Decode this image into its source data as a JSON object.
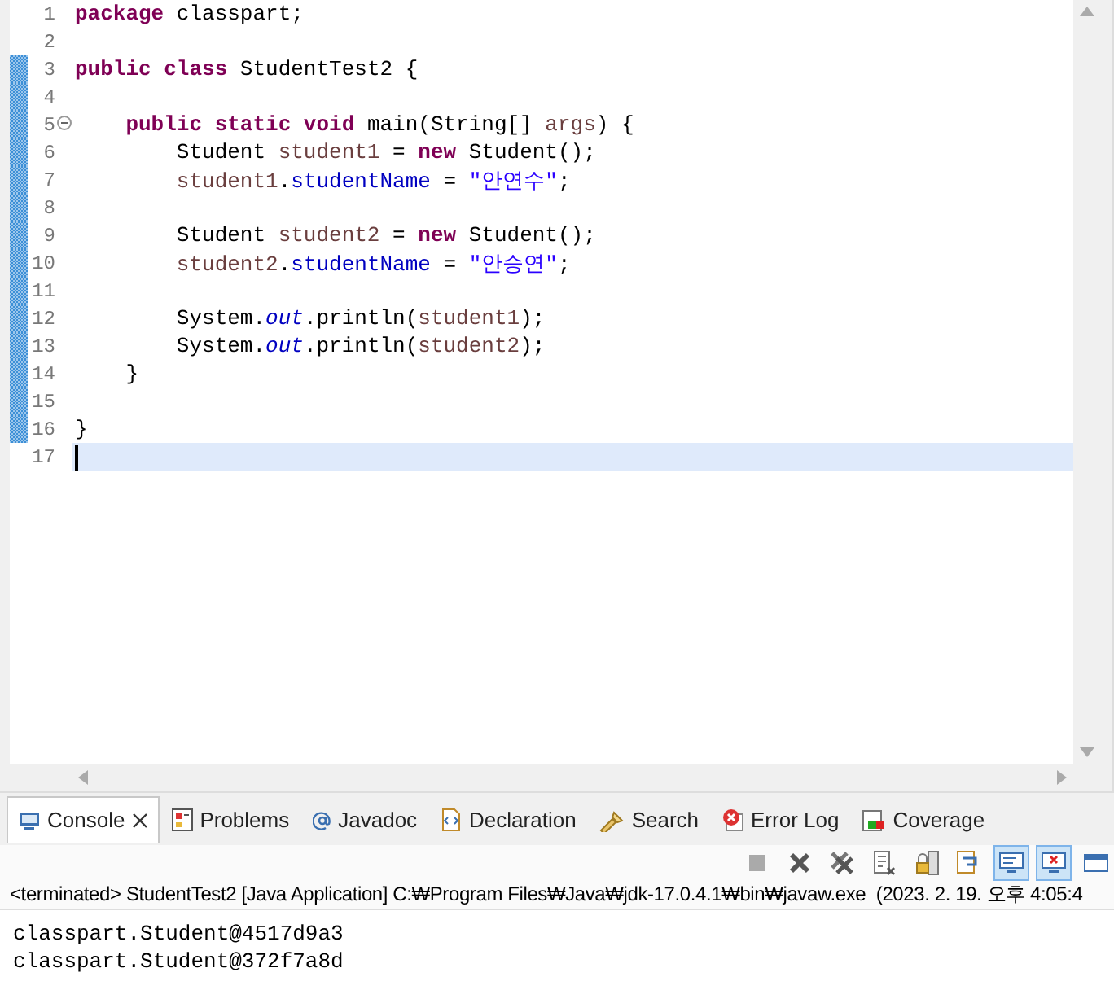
{
  "editor": {
    "lines": [
      {
        "number": "1",
        "changed": false,
        "fold": false,
        "current": false,
        "tokens": [
          {
            "kind": "kw",
            "text": "package"
          },
          {
            "kind": "plain",
            "text": " classpart;"
          }
        ]
      },
      {
        "number": "2",
        "changed": false,
        "fold": false,
        "current": false
      },
      {
        "number": "3",
        "changed": true,
        "fold": false,
        "current": false,
        "tokens": [
          {
            "kind": "kw",
            "text": "public class"
          },
          {
            "kind": "plain",
            "text": " StudentTest2 {"
          }
        ]
      },
      {
        "number": "4",
        "changed": true,
        "fold": false,
        "current": false
      },
      {
        "number": "5",
        "changed": true,
        "fold": true,
        "current": false,
        "tokens": [
          {
            "kind": "kw",
            "text": "    public static void"
          },
          {
            "kind": "plain",
            "text": " main(String[] "
          },
          {
            "kind": "var",
            "text": "args"
          },
          {
            "kind": "plain",
            "text": ") {"
          }
        ]
      },
      {
        "number": "6",
        "changed": true,
        "fold": false,
        "current": false,
        "tokens": [
          {
            "kind": "plain",
            "text": "        Student "
          },
          {
            "kind": "var",
            "text": "student1"
          },
          {
            "kind": "plain",
            "text": " = "
          },
          {
            "kind": "kw",
            "text": "new"
          },
          {
            "kind": "plain",
            "text": " Student();"
          }
        ]
      },
      {
        "number": "7",
        "changed": true,
        "fold": false,
        "current": false,
        "tokens": [
          {
            "kind": "var",
            "text": "        student1"
          },
          {
            "kind": "plain",
            "text": "."
          },
          {
            "kind": "field",
            "text": "studentName"
          },
          {
            "kind": "plain",
            "text": " = "
          },
          {
            "kind": "str",
            "text": "\"안연수\""
          },
          {
            "kind": "plain",
            "text": ";"
          }
        ]
      },
      {
        "number": "8",
        "changed": true,
        "fold": false,
        "current": false
      },
      {
        "number": "9",
        "changed": true,
        "fold": false,
        "current": false,
        "tokens": [
          {
            "kind": "plain",
            "text": "        Student "
          },
          {
            "kind": "var",
            "text": "student2"
          },
          {
            "kind": "plain",
            "text": " = "
          },
          {
            "kind": "kw",
            "text": "new"
          },
          {
            "kind": "plain",
            "text": " Student();"
          }
        ]
      },
      {
        "number": "10",
        "changed": true,
        "fold": false,
        "current": false,
        "tokens": [
          {
            "kind": "var",
            "text": "        student2"
          },
          {
            "kind": "plain",
            "text": "."
          },
          {
            "kind": "field",
            "text": "studentName"
          },
          {
            "kind": "plain",
            "text": " = "
          },
          {
            "kind": "str",
            "text": "\"안승연\""
          },
          {
            "kind": "plain",
            "text": ";"
          }
        ]
      },
      {
        "number": "11",
        "changed": true,
        "fold": false,
        "current": false
      },
      {
        "number": "12",
        "changed": true,
        "fold": false,
        "current": false,
        "tokens": [
          {
            "kind": "plain",
            "text": "        System."
          },
          {
            "kind": "static",
            "text": "out"
          },
          {
            "kind": "plain",
            "text": ".println("
          },
          {
            "kind": "var",
            "text": "student1"
          },
          {
            "kind": "plain",
            "text": ");"
          }
        ]
      },
      {
        "number": "13",
        "changed": true,
        "fold": false,
        "current": false,
        "tokens": [
          {
            "kind": "plain",
            "text": "        System."
          },
          {
            "kind": "static",
            "text": "out"
          },
          {
            "kind": "plain",
            "text": ".println("
          },
          {
            "kind": "var",
            "text": "student2"
          },
          {
            "kind": "plain",
            "text": ");"
          }
        ]
      },
      {
        "number": "14",
        "changed": true,
        "fold": false,
        "current": false,
        "tokens": [
          {
            "kind": "plain",
            "text": "    }"
          }
        ]
      },
      {
        "number": "15",
        "changed": true,
        "fold": false,
        "current": false
      },
      {
        "number": "16",
        "changed": true,
        "fold": false,
        "current": false,
        "tokens": [
          {
            "kind": "plain",
            "text": "}"
          }
        ]
      },
      {
        "number": "17",
        "changed": false,
        "fold": false,
        "current": true
      }
    ]
  },
  "tabs": [
    {
      "label": "Console",
      "selected": true,
      "closable": true
    },
    {
      "label": "Problems",
      "selected": false,
      "closable": false
    },
    {
      "label": "Javadoc",
      "selected": false,
      "closable": false
    },
    {
      "label": "Declaration",
      "selected": false,
      "closable": false
    },
    {
      "label": "Search",
      "selected": false,
      "closable": false
    },
    {
      "label": "Error Log",
      "selected": false,
      "closable": false
    },
    {
      "label": "Coverage",
      "selected": false,
      "closable": false
    }
  ],
  "toolbar": [
    {
      "kind": "stop",
      "pressed": false
    },
    {
      "kind": "remove",
      "pressed": false
    },
    {
      "kind": "remove-all",
      "pressed": false
    },
    {
      "kind": "clear",
      "pressed": false
    },
    {
      "kind": "lock",
      "pressed": false
    },
    {
      "kind": "word-wrap",
      "pressed": false
    },
    {
      "kind": "show-out",
      "pressed": true
    },
    {
      "kind": "show-err",
      "pressed": true
    },
    {
      "kind": "open",
      "pressed": false
    }
  ],
  "console": {
    "status": "<terminated> StudentTest2 [Java Application] C:₩Program Files₩Java₩jdk-17.0.4.1₩bin₩javaw.exe  (2023. 2. 19. 오후 4:05:4",
    "output": [
      "classpart.Student@4517d9a3",
      "classpart.Student@372f7a8d"
    ]
  }
}
